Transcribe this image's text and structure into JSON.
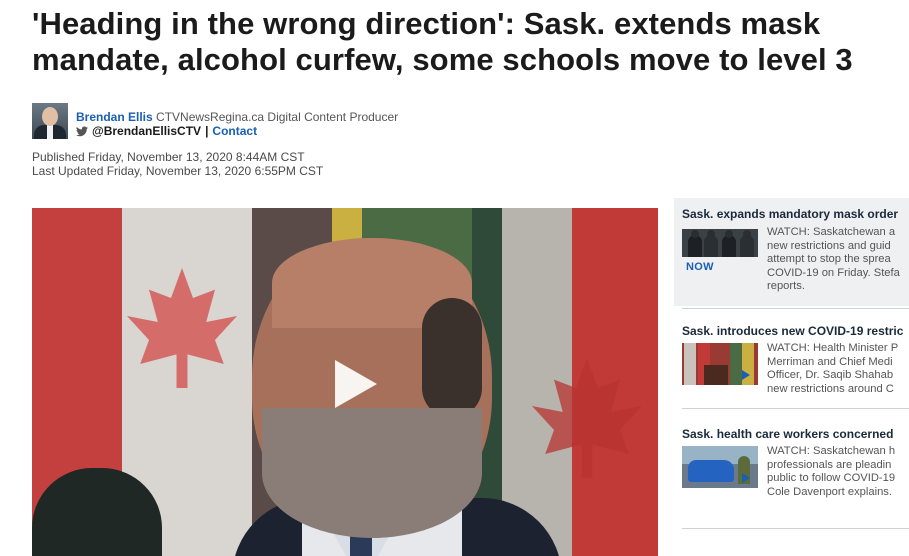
{
  "article": {
    "headline_line1": "'Heading in the wrong direction': Sask. extends mask",
    "headline_line2": "mandate, alcohol curfew, some schools move to level 3",
    "author": {
      "name": "Brendan Ellis",
      "role": "CTVNewsRegina.ca Digital Content Producer",
      "handle": "@BrendanEllisCTV",
      "separator": "|",
      "contact_label": "Contact"
    },
    "published": "Published Friday, November 13, 2020 8:44AM CST",
    "updated": "Last Updated Friday, November 13, 2020 6:55PM CST"
  },
  "video": {
    "play_icon": "play-icon"
  },
  "sidebar": {
    "items": [
      {
        "title": "Sask. expands mandatory mask order",
        "badge": "NOW",
        "lines": [
          "WATCH: Saskatchewan a",
          "new restrictions and guid",
          "attempt to stop the sprea",
          "COVID-19 on Friday. Stefa",
          "reports."
        ]
      },
      {
        "title": "Sask. introduces new COVID-19 restric",
        "badge": "",
        "lines": [
          "WATCH: Health Minister P",
          "Merriman and Chief Medi",
          "Officer, Dr. Saqib Shahab",
          "new restrictions around C"
        ]
      },
      {
        "title": "Sask. health care workers concerned",
        "badge": "",
        "lines": [
          "WATCH: Saskatchewan h",
          "professionals are pleadin",
          "public to follow COVID-19",
          "Cole Davenport explains."
        ]
      }
    ]
  },
  "colors": {
    "link_blue": "#1a5fb4",
    "headline": "#1b1b1b",
    "sidebar_highlight": "#eef0f2"
  }
}
